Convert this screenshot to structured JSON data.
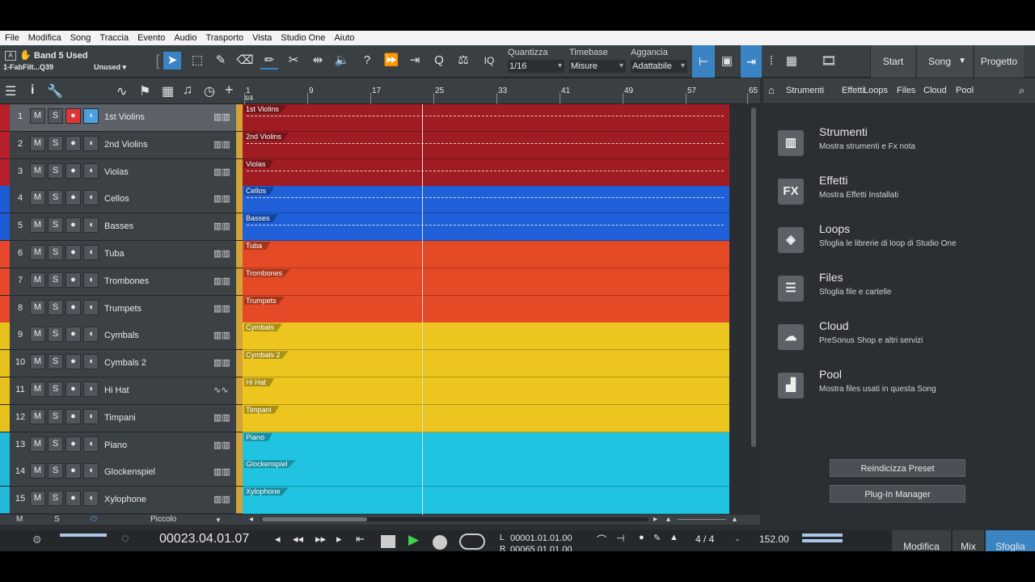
{
  "menu": [
    "File",
    "Modifica",
    "Song",
    "Traccia",
    "Evento",
    "Audio",
    "Trasporto",
    "Vista",
    "Studio One",
    "Aiuto"
  ],
  "toolbar": {
    "preset_name": "Band 5 Used",
    "preset_instrument": "1-FabFilt...Q39",
    "unused_label": "Unused",
    "quantize_label": "Quantizza",
    "quantize_value": "1/16",
    "timebase_label": "Timebase",
    "timebase_value": "Misure",
    "snap_label": "Aggancia",
    "snap_value": "Adattabile",
    "iq_label": "IQ",
    "start_label": "Start",
    "song_label": "Song",
    "project_label": "Progetto"
  },
  "tracks": [
    {
      "num": "1",
      "name": "1st Violins",
      "color": "#b5202a",
      "lane": "#9e1c22",
      "selected": true,
      "rec": true,
      "mon": true
    },
    {
      "num": "2",
      "name": "2nd Violins",
      "color": "#b5202a",
      "lane": "#9e1c22"
    },
    {
      "num": "3",
      "name": "Violas",
      "color": "#b5202a",
      "lane": "#9e1c22"
    },
    {
      "num": "4",
      "name": "Cellos",
      "color": "#1e5bd6",
      "lane": "#1f5fd8"
    },
    {
      "num": "5",
      "name": "Basses",
      "color": "#1e5bd6",
      "lane": "#1f5fd8"
    },
    {
      "num": "6",
      "name": "Tuba",
      "color": "#e5482a",
      "lane": "#e54a26"
    },
    {
      "num": "7",
      "name": "Trombones",
      "color": "#e5482a",
      "lane": "#e54a26"
    },
    {
      "num": "8",
      "name": "Trumpets",
      "color": "#e5482a",
      "lane": "#e54a26"
    },
    {
      "num": "9",
      "name": "Cymbals",
      "color": "#e8c21c",
      "lane": "#ecc61e"
    },
    {
      "num": "10",
      "name": "Cymbals 2",
      "color": "#e8c21c",
      "lane": "#ecc61e"
    },
    {
      "num": "11",
      "name": "Hi Hat",
      "color": "#e8c21c",
      "lane": "#ecc61e",
      "audio": true
    },
    {
      "num": "12",
      "name": "Timpani",
      "color": "#e8c21c",
      "lane": "#ecc61e"
    },
    {
      "num": "13",
      "name": "Piano",
      "color": "#22b9d8",
      "lane": "#20c4e0"
    },
    {
      "num": "14",
      "name": "Glockenspiel",
      "color": "#22b9d8",
      "lane": "#20c4e0"
    },
    {
      "num": "15",
      "name": "Xylophone",
      "color": "#22b9d8",
      "lane": "#20c4e0"
    }
  ],
  "track_buttons": {
    "mute": "M",
    "solo": "S"
  },
  "ruler": {
    "signature": "4/4",
    "marks": [
      "1",
      "9",
      "17",
      "25",
      "33",
      "41",
      "49",
      "57",
      "65"
    ]
  },
  "browser": {
    "tabs": [
      "Strumenti",
      "Effetti",
      "Loops",
      "Files",
      "Cloud",
      "Pool"
    ],
    "items": [
      {
        "title": "Strumenti",
        "desc": "Mostra strumenti e Fx nota",
        "icon": "keyboard-icon",
        "glyph": "▥"
      },
      {
        "title": "Effetti",
        "desc": "Mostra Effetti Installati",
        "icon": "fx-icon",
        "glyph": "FX"
      },
      {
        "title": "Loops",
        "desc": "Sfoglia le librerie di loop di Studio One",
        "icon": "loops-icon",
        "glyph": "◈"
      },
      {
        "title": "Files",
        "desc": "Sfoglia file e cartelle",
        "icon": "files-icon",
        "glyph": "☰"
      },
      {
        "title": "Cloud",
        "desc": "PreSonus Shop e altri servizi",
        "icon": "cloud-icon",
        "glyph": "☁"
      },
      {
        "title": "Pool",
        "desc": "Mostra files usati in questa Song",
        "icon": "pool-icon",
        "glyph": "▟"
      }
    ],
    "reindex_label": "Reindicizza Preset",
    "plugin_manager_label": "Plug-In Manager"
  },
  "bottom": {
    "m_label": "M",
    "s_label": "S",
    "instrument": "Piccolo"
  },
  "transport": {
    "position": "00023.04.01.07",
    "loop_start": "00001.01.01.00",
    "loop_end": "00065.01.01.00",
    "signature": "4 / 4",
    "dash": "-",
    "tempo": "152.00",
    "l_label": "L",
    "r_label": "R",
    "pages": [
      "Modifica",
      "Mix",
      "Sfoglia"
    ]
  }
}
